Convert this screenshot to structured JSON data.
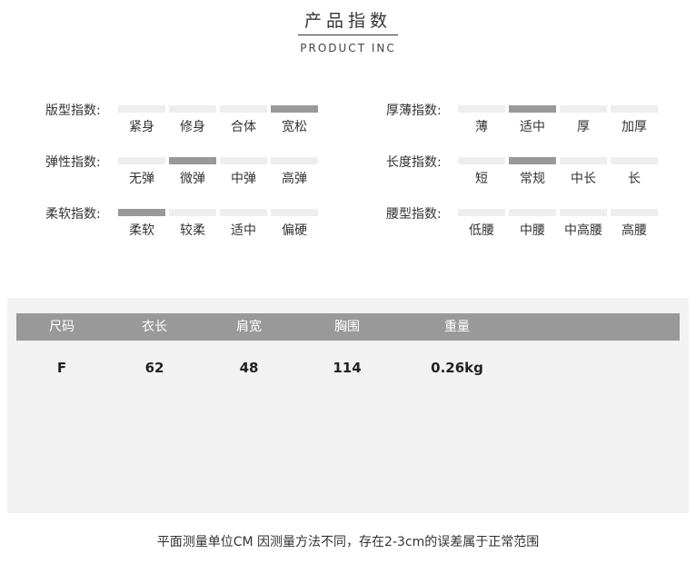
{
  "header": {
    "title": "产品指数",
    "subtitle": "PRODUCT INC"
  },
  "indices": {
    "left": [
      {
        "label": "版型指数:",
        "options": [
          "紧身",
          "修身",
          "合体",
          "宽松"
        ],
        "selected": 3
      },
      {
        "label": "弹性指数:",
        "options": [
          "无弹",
          "微弹",
          "中弹",
          "高弹"
        ],
        "selected": 1
      },
      {
        "label": "柔软指数:",
        "options": [
          "柔软",
          "较柔",
          "适中",
          "偏硬"
        ],
        "selected": 0
      }
    ],
    "right": [
      {
        "label": "厚薄指数:",
        "options": [
          "薄",
          "适中",
          "厚",
          "加厚"
        ],
        "selected": 1
      },
      {
        "label": "长度指数:",
        "options": [
          "短",
          "常规",
          "中长",
          "长"
        ],
        "selected": 1
      },
      {
        "label": "腰型指数:",
        "options": [
          "低腰",
          "中腰",
          "中高腰",
          "高腰"
        ],
        "selected": -1
      }
    ]
  },
  "size_table": {
    "headers": [
      "尺码",
      "衣长",
      "肩宽",
      "胸围",
      "重量"
    ],
    "rows": [
      [
        "F",
        "62",
        "48",
        "114",
        "0.26kg"
      ]
    ]
  },
  "note": "平面测量单位CM 因测量方法不同，存在2-3cm的误差属于正常范围",
  "colors": {
    "bar_on": "#999999",
    "bar_off": "#eeeeee",
    "header_bg": "#999999",
    "panel_bg": "#f2f2f2"
  }
}
